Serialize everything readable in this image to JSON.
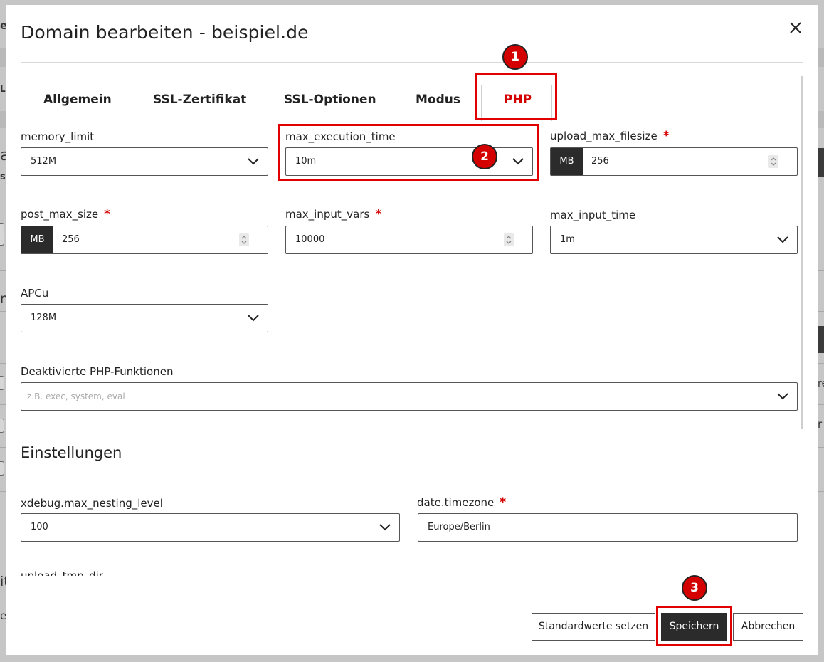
{
  "dialog": {
    "title": "Domain bearbeiten - beispiel.de"
  },
  "tabs": [
    {
      "label": "Allgemein",
      "active": false
    },
    {
      "label": "SSL-Zertifikat",
      "active": false
    },
    {
      "label": "SSL-Optionen",
      "active": false
    },
    {
      "label": "Modus",
      "active": false
    },
    {
      "label": "PHP",
      "active": true
    }
  ],
  "fields": {
    "memory_limit": {
      "label": "memory_limit",
      "value": "512M"
    },
    "max_execution_time": {
      "label": "max_execution_time",
      "value": "10m"
    },
    "upload_max_filesize": {
      "label": "upload_max_filesize",
      "required": "*",
      "unit": "MB",
      "value": "256"
    },
    "post_max_size": {
      "label": "post_max_size",
      "required": "*",
      "unit": "MB",
      "value": "256"
    },
    "max_input_vars": {
      "label": "max_input_vars",
      "required": "*",
      "value": "10000"
    },
    "max_input_time": {
      "label": "max_input_time",
      "value": "1m"
    },
    "apcu": {
      "label": "APCu",
      "value": "128M"
    },
    "disabled_functions": {
      "label": "Deaktivierte PHP-Funktionen",
      "placeholder": "z.B. exec, system, eval"
    }
  },
  "settings": {
    "title": "Einstellungen",
    "xdebug_max_nesting_level": {
      "label": "xdebug.max_nesting_level",
      "value": "100"
    },
    "date_timezone": {
      "label": "date.timezone",
      "required": "*",
      "value": "Europe/Berlin"
    },
    "upload_tmp_dir": {
      "label": "upload_tmp_dir"
    }
  },
  "footer": {
    "defaults_button": "Standardwerte setzen",
    "save_button": "Speichern",
    "cancel_button": "Abbrechen"
  },
  "annotations": [
    "1",
    "2",
    "3"
  ],
  "background": {
    "fragments": [
      "er",
      "Li",
      "a",
      "s",
      "m",
      "it",
      "e",
      "re",
      "r"
    ]
  },
  "colors": {
    "accent": "#d40000",
    "dark_button": "#2b2b2b",
    "highlight": "#e00000"
  }
}
